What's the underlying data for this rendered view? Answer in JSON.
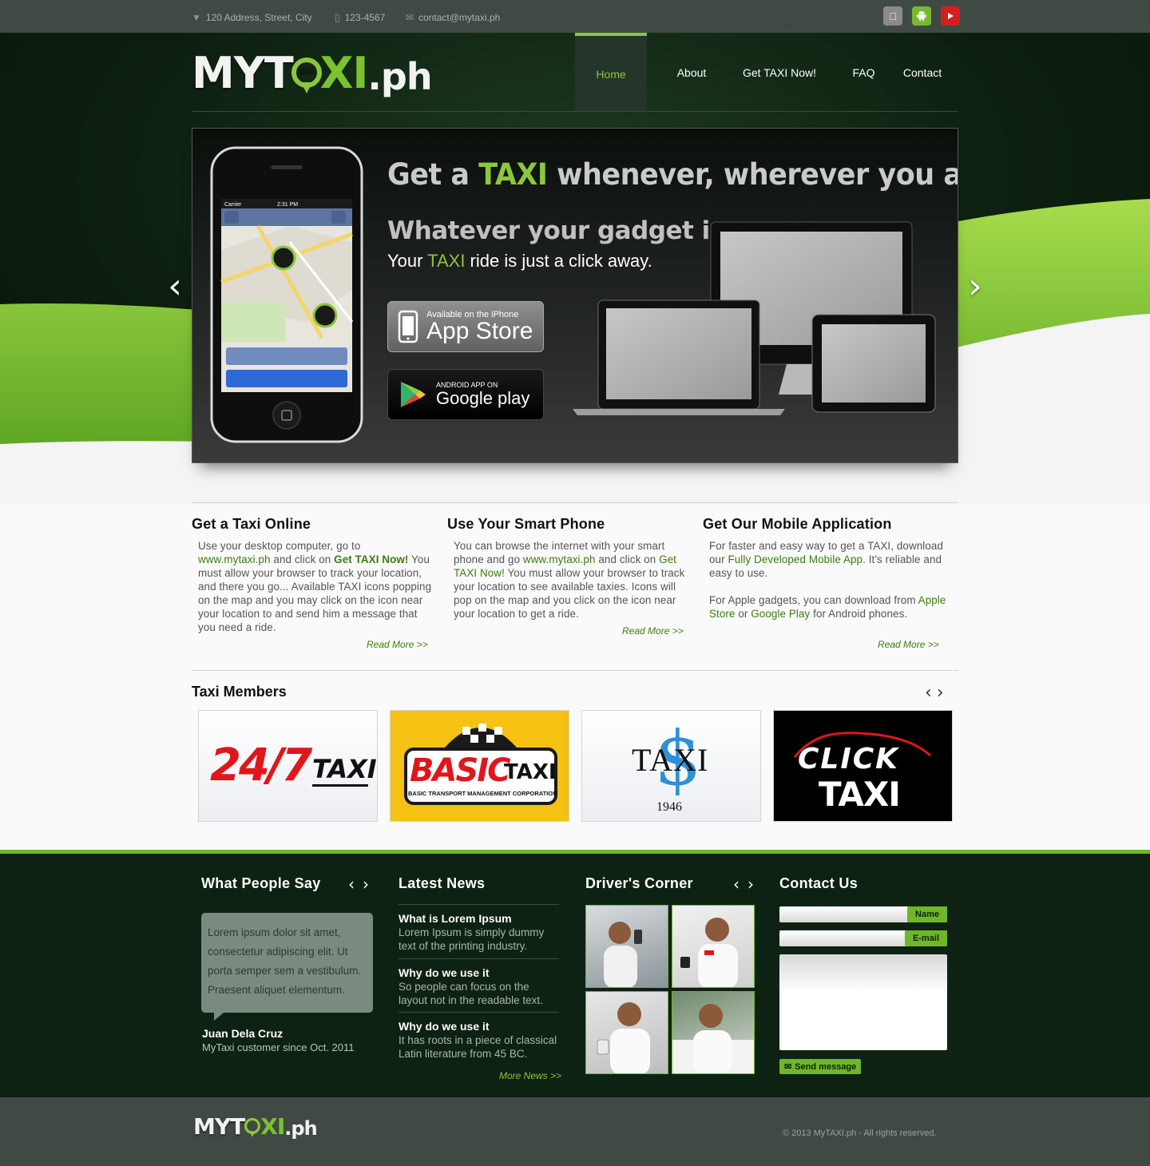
{
  "topbar": {
    "address": "120 Address, Street, City",
    "phone": "123-4567",
    "email": "contact@mytaxi.ph",
    "social": [
      {
        "icon": "apple-icon",
        "color": "#8a8a8a"
      },
      {
        "icon": "android-icon",
        "color": "#7ab830"
      },
      {
        "icon": "youtube-icon",
        "color": "#d41f1f"
      }
    ]
  },
  "logo": {
    "part1": "MYT",
    "part2": "XI",
    "suffix": ".ph"
  },
  "nav": [
    {
      "label": "Home",
      "active": true
    },
    {
      "label": "About"
    },
    {
      "label": "Get TAXI Now!"
    },
    {
      "label": "FAQ"
    },
    {
      "label": "Contact"
    }
  ],
  "hero": {
    "headline_pre": "Get a ",
    "headline_hl": "TAXI",
    "headline_post": " whenever, wherever you are",
    "subhead": "Whatever your gadget is...",
    "tagline_pre": "Your ",
    "tagline_hl": "TAXI",
    "tagline_post": " ride is just a click away.",
    "appstore_small": "Available on the iPhone",
    "appstore_big": "App Store",
    "gplay_small": "ANDROID APP ON",
    "gplay_big": "Google play",
    "phone_carrier": "Carrier",
    "phone_time": "2:31 PM",
    "prev": "‹",
    "next": "›"
  },
  "features": [
    {
      "title": "Get a Taxi Online",
      "p1": "Use your desktop computer, go to",
      "link": "www.mytaxi.ph",
      "p2": " and click on ",
      "cta": "Get TAXI Now!",
      "p3": " You must allow your browser to track your location, and there you go... Available TAXI icons popping on the map and you may click on the icon near your location to and send him a message that you need a ride.",
      "readmore": "Read More >>"
    },
    {
      "title": "Use Your Smart Phone",
      "p1": "You can browse the internet with your smart phone and go ",
      "link": "www.mytaxi.ph",
      "p2": " and click on ",
      "cta": "Get TAXI Now!",
      "p3": " You must allow your browser to track your location to see available taxies. Icons will pop on the map and you click on the icon near your location to get a ride.",
      "readmore": "Read More >>"
    },
    {
      "title": "Get Our Mobile Application",
      "p1": "For faster and easy way to get a TAXI, download our ",
      "link": "Fully Developed Mobile App",
      "p2": ". It's reliable and easy to use.",
      "p4": "For Apple gadgets, you can download from ",
      "link2": "Apple Store",
      "p5": " or ",
      "link3": "Google Play",
      "p6": " for Android phones.",
      "readmore": "Read More >>"
    }
  ],
  "members": {
    "title": "Taxi Members",
    "prev": "‹",
    "next": "›",
    "items": [
      {
        "name": "24/7",
        "name2": "TAXI"
      },
      {
        "name": "BASIC",
        "name2": "TAXI",
        "sub": "BASIC TRANSPORT MANAGEMENT CORPORATION"
      },
      {
        "name": "TAXI",
        "year": "1946"
      },
      {
        "name": "CLICK",
        "name2": "TAXI"
      }
    ]
  },
  "testimonials": {
    "title": "What People Say",
    "quote": "Lorem ipsum dolor sit amet, consectetur adipiscing elit. Ut porta semper sem a vestibulum. Praesent aliquet elementum.",
    "name": "Juan Dela Cruz",
    "since": "MyTaxi customer since Oct. 2011"
  },
  "news": {
    "title": "Latest News",
    "items": [
      {
        "title": "What is Lorem Ipsum",
        "text": "Lorem Ipsum is simply dummy text of the printing industry."
      },
      {
        "title": "Why do we use it",
        "text": "So people can focus on the layout not in the readable text."
      },
      {
        "title": "Why do we use it",
        "text": "It has roots in a piece of classical Latin literature from 45 BC."
      }
    ],
    "more": "More News >>"
  },
  "drivers": {
    "title": "Driver's Corner"
  },
  "contact": {
    "title": "Contact Us",
    "name_label": "Name",
    "email_label": "E-mail",
    "send": "Send message"
  },
  "footer": {
    "copyright": "© 2013 MyTAXI.ph - All rights reserved."
  }
}
